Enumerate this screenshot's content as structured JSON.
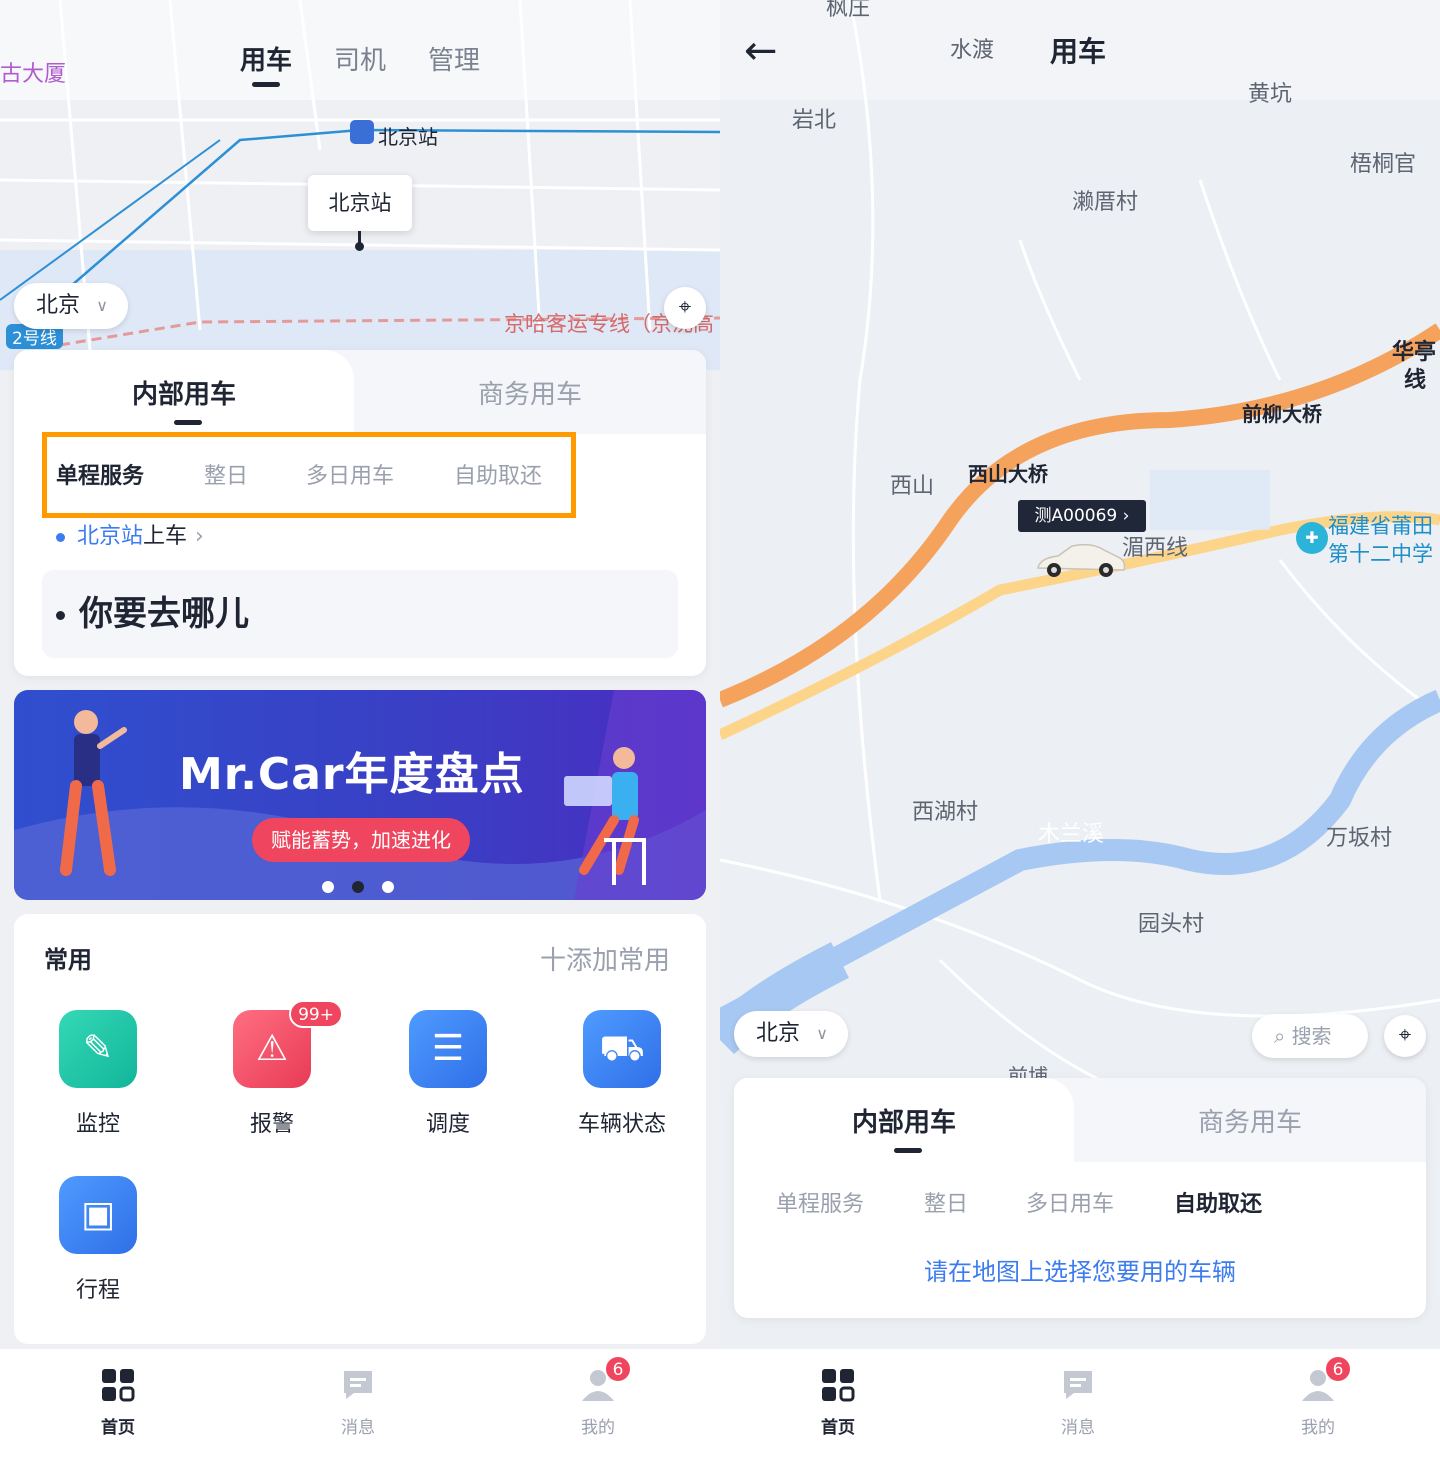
{
  "left": {
    "map_labels": [
      "古大厦",
      "北京站",
      "京哈客运专线（京沈高",
      "2号线"
    ],
    "nav": {
      "tabs": [
        "用车",
        "司机",
        "管理"
      ],
      "active": "用车"
    },
    "pin_label": "北京站",
    "city": "北京",
    "card": {
      "tabs": [
        "内部用车",
        "商务用车"
      ],
      "services": [
        "单程服务",
        "整日",
        "多日用车",
        "自助取还"
      ],
      "active_service": "单程服务",
      "pickup_place": "北京站",
      "pickup_suffix": "上车",
      "destination_placeholder": "你要去哪儿"
    },
    "banner": {
      "title": "Mr.Car年度盘点",
      "subtitle": "赋能蓄势，加速进化",
      "page_count": 3
    },
    "favorites": {
      "title": "常用",
      "add_label": "十添加常用",
      "items": [
        {
          "label": "监控",
          "icon": "monitor-icon",
          "color": "#1ec9a8"
        },
        {
          "label": "报警",
          "icon": "alarm-icon",
          "color": "#f0455e",
          "badge": "99+"
        },
        {
          "label": "调度",
          "icon": "dispatch-icon",
          "color": "#3a7cf0"
        },
        {
          "label": "车辆状态",
          "icon": "car-status-icon",
          "color": "#3a7cf0"
        },
        {
          "label": "行程",
          "icon": "trip-icon",
          "color": "#3a7cf0"
        }
      ]
    }
  },
  "right": {
    "title": "用车",
    "map_labels": [
      "枫庄",
      "水渡",
      "岩北",
      "黄坑",
      "梧桐官",
      "濑厝村",
      "华亭",
      "线",
      "前柳大桥",
      "西山",
      "西山大桥",
      "湄西线",
      "西湖村",
      "木兰溪",
      "万坂村",
      "园头村",
      "前埔"
    ],
    "poi": {
      "line1": "福建省莆田",
      "line2": "第十二中学"
    },
    "plate": "测A00069",
    "city": "北京",
    "search_label": "搜索",
    "card": {
      "tabs": [
        "内部用车",
        "商务用车"
      ],
      "services": [
        "单程服务",
        "整日",
        "多日用车",
        "自助取还"
      ],
      "active_service": "自助取还",
      "hint": "请在地图上选择您要用的车辆"
    }
  },
  "bottom_nav": {
    "items": [
      {
        "label": "首页",
        "icon": "home-grid-icon"
      },
      {
        "label": "消息",
        "icon": "message-icon"
      },
      {
        "label": "我的",
        "icon": "profile-icon",
        "badge": "6"
      }
    ],
    "active": "首页"
  }
}
